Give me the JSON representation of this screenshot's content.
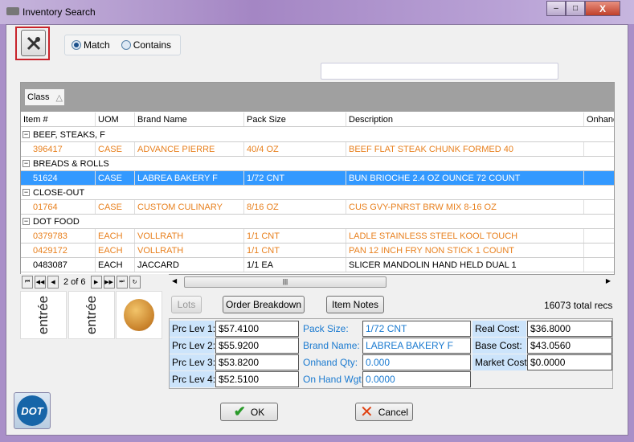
{
  "window": {
    "title": "Inventory Search",
    "minimize": "–",
    "maximize": "□",
    "close": "X"
  },
  "toolbar": {
    "tools_icon": "wrench-screwdriver-icon",
    "match": "Match",
    "contains": "Contains",
    "selected": "Match",
    "search_value": ""
  },
  "grid": {
    "group_by": "Class",
    "columns": [
      "Item #",
      "UOM",
      "Brand Name",
      "Pack Size",
      "Description",
      "Onhand"
    ],
    "groups": [
      {
        "name": "BEEF, STEAKS, F",
        "rows": [
          [
            "396417",
            "CASE",
            "ADVANCE PIERRE",
            "40/4 OZ",
            "BEEF FLAT STEAK CHUNK FORMED 40",
            ""
          ]
        ]
      },
      {
        "name": "BREADS & ROLLS",
        "rows": [
          [
            "51624",
            "CASE",
            "LABREA BAKERY F",
            "1/72 CNT",
            "BUN BRIOCHE 2.4 OZ OUNCE 72 COUNT",
            ""
          ]
        ]
      },
      {
        "name": "CLOSE-OUT",
        "rows": [
          [
            "01764",
            "CASE",
            "CUSTOM CULINARY",
            "8/16 OZ",
            "CUS GVY-PNRST BRW MIX 8-16 OZ",
            ""
          ]
        ]
      },
      {
        "name": "DOT FOOD",
        "rows": [
          [
            "0379783",
            "EACH",
            "VOLLRATH",
            "1/1 CNT",
            "LADLE STAINLESS STEEL KOOL TOUCH",
            ""
          ],
          [
            "0429172",
            "EACH",
            "VOLLRATH",
            "1/1 CNT",
            "PAN 12 INCH FRY NON STICK 1 COUNT",
            ""
          ],
          [
            "0483087",
            "EACH",
            "JACCARD",
            "1/1 EA",
            "SLICER MANDOLIN HAND HELD DUAL 1",
            ""
          ]
        ]
      }
    ],
    "selected_item": "51624",
    "colors": {
      "orange_text": "#e8801e",
      "selected": "#3399ff"
    }
  },
  "pager": {
    "text": "2 of 6"
  },
  "actions": {
    "lots": "Lots",
    "order_breakdown": "Order Breakdown",
    "item_notes": "Item Notes",
    "total": "16073 total recs"
  },
  "images": {
    "logo1": "entree",
    "logo2": "entree",
    "photo": "bun-photo"
  },
  "details": {
    "prc1_label": "Prc Lev  1:",
    "prc1": "$57.4100",
    "prc2_label": "Prc Lev  2:",
    "prc2": "$55.9200",
    "prc3_label": "Prc Lev  3:",
    "prc3": "$53.8200",
    "prc4_label": "Prc Lev  4:",
    "prc4": "$52.5100",
    "pack_label": "Pack Size:",
    "pack": "1/72 CNT",
    "brand_label": "Brand Name:",
    "brand": "LABREA BAKERY F",
    "onhand_label": "Onhand Qty:",
    "onhand": "0.000",
    "wgt_label": "On Hand Wgt:",
    "wgt": "0.0000",
    "real_label": "Real Cost:",
    "real": "$36.8000",
    "base_label": "Base Cost:",
    "base": "$43.0560",
    "market_label": "Market Cost:",
    "market": "$0.0000"
  },
  "footer": {
    "ok": "OK",
    "cancel": "Cancel",
    "logo": "DOT"
  }
}
